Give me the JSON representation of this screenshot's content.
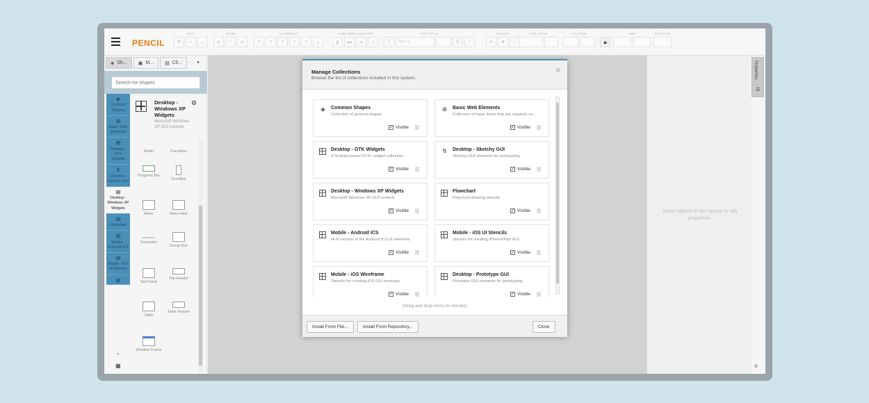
{
  "app": {
    "brand": "PENCIL"
  },
  "toolbar": {
    "groups": [
      "EDIT",
      "ZOOM",
      "ALIGNMENT",
      "SAME SIZES & SPACES",
      "TEXT STYLE",
      "COLORS",
      "LINE STYLE",
      "LOCATION",
      "SIZE",
      "ROTATION"
    ],
    "font_placeholder": "Sans S"
  },
  "left": {
    "tabs": [
      {
        "label": "Sh...",
        "icon": "layers-icon"
      },
      {
        "label": "M...",
        "icon": "briefcase-icon"
      },
      {
        "label": "Cli...",
        "icon": "clipboard-icon"
      }
    ],
    "search_placeholder": "Search for shapes",
    "categories": [
      {
        "label": "Common Shapes",
        "icon": "layers-icon"
      },
      {
        "label": "Basic Web Elements",
        "icon": "globe-icon"
      },
      {
        "label": "Desktop - GTK Widgets",
        "icon": "grid-icon"
      },
      {
        "label": "Desktop - Sketchy GUI",
        "icon": "squiggle-icon"
      },
      {
        "label": "Desktop - Windows XP Widgets",
        "icon": "grid-icon"
      },
      {
        "label": "Flowchart",
        "icon": "grid-icon"
      },
      {
        "label": "Mobile - Android ICS",
        "icon": "grid-icon"
      },
      {
        "label": "Mobile - iOS UI Stencils",
        "icon": "grid-icon"
      }
    ],
    "collection": {
      "title": "Desktop - Windows XP Widgets",
      "desc": "Microsoft Windows XP GUI controls"
    },
    "shapes": [
      "Radio",
      "Checkbox",
      "Progress Bar",
      "Scrollbar",
      "Menu",
      "Menu Item",
      "Separator",
      "Group Box",
      "Tab Panel",
      "Tab Header",
      "Table",
      "Table Header",
      "Window Frame"
    ]
  },
  "right": {
    "empty_text": "Select objects in the canvas to edit properties.",
    "tab_label": "Properties"
  },
  "dialog": {
    "title": "Manage Collections",
    "subtitle": "Browse the list of collections installed in this system.",
    "visible_label": "Visible",
    "drag_hint": "(Drag and drop items to reorder)",
    "collections": [
      {
        "title": "Common Shapes",
        "desc": "Collection of general shapes",
        "icon": "layers-icon"
      },
      {
        "title": "Basic Web Elements",
        "desc": "Collection of basic items that are regularly us...",
        "icon": "globe-icon"
      },
      {
        "title": "Desktop - GTK Widgets",
        "desc": "A Nodoka-based GTK+ widget collection",
        "icon": "grid-icon"
      },
      {
        "title": "Desktop - Sketchy GUI",
        "desc": "Sketchy GUI elements for prototyping",
        "icon": "squiggle-icon"
      },
      {
        "title": "Desktop - Windows XP Widgets",
        "desc": "Microsoft Windows XP GUI controls",
        "icon": "grid-icon"
      },
      {
        "title": "Flowchart",
        "desc": "Flowchart drawing stencils",
        "icon": "grid-icon"
      },
      {
        "title": "Mobile - Android ICS",
        "desc": "Hi-Fi version of the Android ICS UI elements",
        "icon": "grid-icon"
      },
      {
        "title": "Mobile - iOS UI Stencils",
        "desc": "Stencils for creating iPhone/iPad GUI",
        "icon": "grid-icon"
      },
      {
        "title": "Mobile - iOS Wireframe",
        "desc": "Stencils for creating iOS GUI mockups",
        "icon": "grid-icon"
      },
      {
        "title": "Desktop - Prototype GUI",
        "desc": "Prototype GUI elements for prototyping",
        "icon": "grid-icon"
      }
    ],
    "buttons": {
      "install_file": "Install From File...",
      "install_repo": "Install From Repository...",
      "close": "Close"
    }
  },
  "colors": {
    "brand": "#e37e10",
    "accent": "#4a8fb8",
    "canvas": "#d2d2d2"
  }
}
